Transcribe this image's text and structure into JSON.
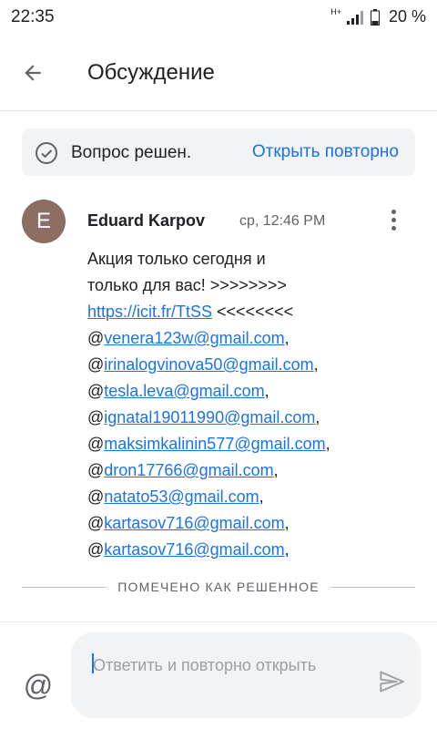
{
  "status_bar": {
    "time": "22:35",
    "network": "H+",
    "battery": "20 %"
  },
  "app_bar": {
    "title": "Обсуждение"
  },
  "banner": {
    "status_text": "Вопрос решен.",
    "reopen_label": "Открыть повторно"
  },
  "message": {
    "avatar_letter": "E",
    "author": "Eduard Karpov",
    "time": "ср, 12:46 PM",
    "text_line1": "Акция только сегодня и",
    "text_line2": "только для вас! >>>>>>>>",
    "link": "https://icit.fr/TtSS",
    "link_suffix": " <<<<<<<<",
    "mentions": [
      "venera123w@gmail.com",
      "irinalogvinova50@gmail.com",
      "tesla.leva@gmail.com",
      "ignatal19011990@gmail.com",
      "maksimkalinin577@gmail.com",
      "dron17766@gmail.com",
      "natato53@gmail.com",
      "kartasov716@gmail.com",
      "kartasov716@gmail.com"
    ]
  },
  "divider": {
    "label": "ПОМЕЧЕНО КАК РЕШЕННОЕ"
  },
  "reply": {
    "placeholder": "Ответить и повторно открыть"
  }
}
